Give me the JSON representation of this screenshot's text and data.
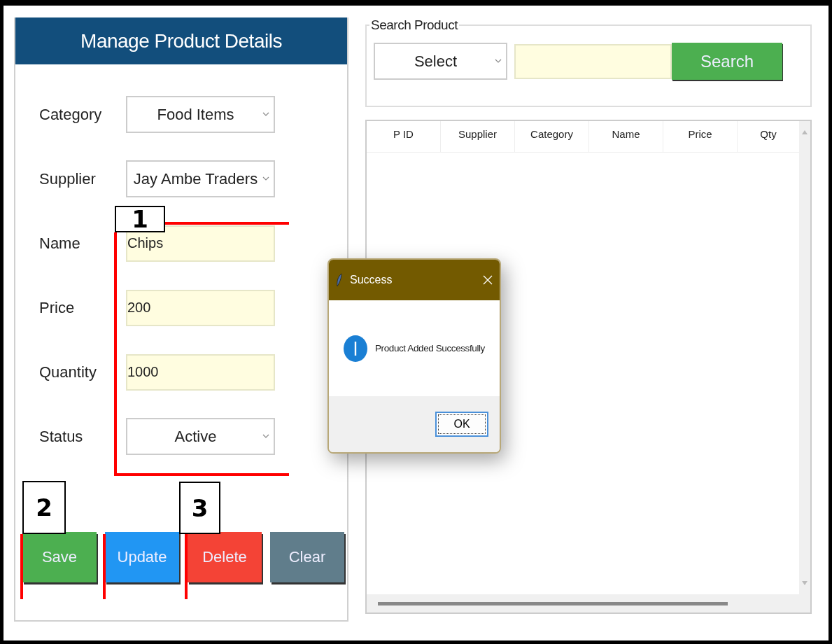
{
  "form": {
    "title": "Manage Product Details",
    "fields": [
      {
        "label": "Category",
        "kind": "combo",
        "value": "Food Items"
      },
      {
        "label": "Supplier",
        "kind": "combo",
        "value": "Jay Ambe Traders"
      },
      {
        "label": "Name",
        "kind": "text",
        "value": "Chips"
      },
      {
        "label": "Price",
        "kind": "text",
        "value": "200"
      },
      {
        "label": "Quantity",
        "kind": "text",
        "value": "1000"
      },
      {
        "label": "Status",
        "kind": "combo",
        "value": "Active"
      }
    ],
    "buttons": [
      {
        "label": "Save",
        "color": "#4caf50"
      },
      {
        "label": "Update",
        "color": "#2196f3"
      },
      {
        "label": "Delete",
        "color": "#f44336"
      },
      {
        "label": "Clear",
        "color": "#607d8b"
      }
    ]
  },
  "search": {
    "title": "Search Product",
    "filter": "Select",
    "button": "Search"
  },
  "table": {
    "columns": [
      "P ID",
      "Supplier",
      "Category",
      "Name",
      "Price",
      "Qty"
    ]
  },
  "dialog": {
    "title": "Success",
    "message": "Product Added Successfully",
    "button": "OK"
  },
  "annotations": [
    {
      "label": "1"
    },
    {
      "label": "2"
    },
    {
      "label": "3"
    }
  ]
}
